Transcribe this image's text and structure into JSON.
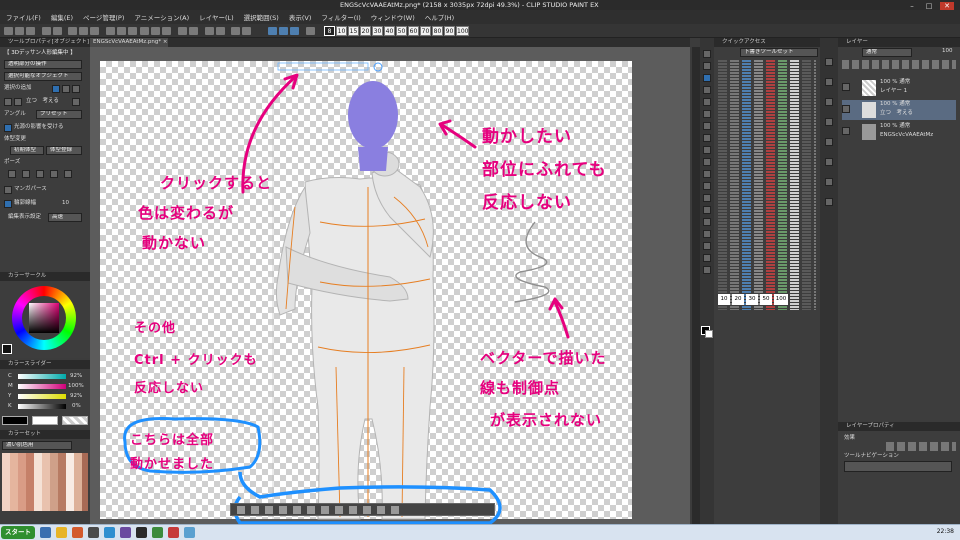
{
  "window": {
    "title": "ENGScVcVAAEAtMz.png* (2158 x 3035px 72dpi 49.3%) - CLIP STUDIO PAINT EX"
  },
  "menu": [
    "ファイル(F)",
    "編集(E)",
    "ページ管理(P)",
    "アニメーション(A)",
    "レイヤー(L)",
    "選択範囲(S)",
    "表示(V)",
    "フィルター(I)",
    "ウィンドウ(W)",
    "ヘルプ(H)"
  ],
  "brush_sizes": [
    "8",
    "10",
    "15",
    "20",
    "30",
    "40",
    "50",
    "60",
    "70",
    "80",
    "90",
    "100"
  ],
  "document_tab": "ENGScVcVAAEAtMz.png* ×",
  "tool_property": {
    "header": "ツールプロパティ[オブジェクト]",
    "mode": "【 3Dデッサン人形編集中 】",
    "row1": "透明部分の操作",
    "row2": "選択可能なオブジェクト",
    "row3": "選択の追加",
    "row4": "立つ　考える",
    "angle_label": "アングル",
    "preset_label": "プリセット",
    "light_label": "光源の影響を受ける",
    "body_label": "体型変更",
    "body_btn1": "初期体型",
    "body_btn2": "体型登録",
    "pose_label": "ポーズ",
    "manga_label": "マンガパース",
    "outline_label": "輪郭線幅",
    "outline_value": "10",
    "edit_label": "編集表示設定",
    "edit_value": "高速"
  },
  "color_circle": {
    "header": "カラーサークル"
  },
  "color_slider": {
    "header": "カラースライダー",
    "labels": [
      "C",
      "M",
      "Y",
      "K"
    ],
    "values": [
      "92%",
      "100%",
      "92%",
      "0%"
    ]
  },
  "color_set": {
    "header": "カラーセット",
    "name": "濃い肌色用"
  },
  "quick_access": {
    "header": "クイックアクセス",
    "set": "下書きツールセット"
  },
  "layer_panel": {
    "header": "レイヤー",
    "blend": "通常",
    "opacity": "100",
    "layers": [
      {
        "line1": "100 % 通常",
        "line2": "レイヤー 1"
      },
      {
        "line1": "100 % 通常",
        "line2": "立つ　考える"
      },
      {
        "line1": "100 % 通常",
        "line2": "ENGScVcVAAEAtMz"
      }
    ]
  },
  "layer_property": {
    "header": "レイヤープロパティ",
    "effect_label": "効果",
    "ruler_label": "ツールナビゲーション"
  },
  "quick_sizes": [
    "10",
    "20",
    "30",
    "50",
    "100"
  ],
  "annotations": {
    "a1_line1": "クリックすると",
    "a1_line2": "色は変わるが",
    "a1_line3": "動かない",
    "a2_line1": "動かしたい",
    "a2_line2": "部位にふれても",
    "a2_line3": "反応しない",
    "a3_line1": "その他",
    "a3_line2": "Ctrl + クリックも",
    "a3_line3": "反応しない",
    "a4_line1": "ベクターで描いた",
    "a4_line2": "線も制御点",
    "a4_line3": "が表示されない",
    "a5_line1": "こちらは全部",
    "a5_line2": "動かせました"
  },
  "taskbar": {
    "start": "スタート",
    "time": "22:38"
  },
  "colors": {
    "accent_pink": "#e6007e",
    "accent_blue": "#1e90ff",
    "figure_head": "#8a7fe0"
  }
}
